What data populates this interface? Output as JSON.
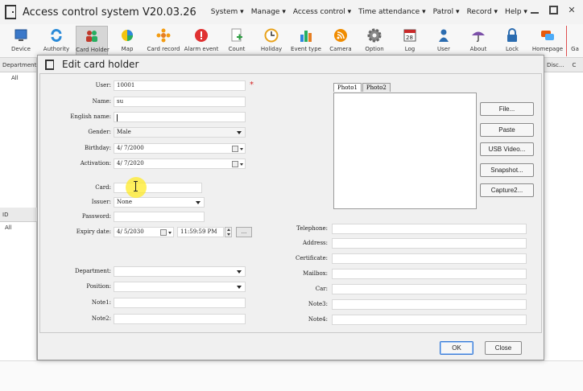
{
  "app": {
    "title": "Access control system V20.03.26",
    "menu": [
      "System ▾",
      "Manage ▾",
      "Access control ▾",
      "Time attendance ▾",
      "Patrol ▾",
      "Record ▾",
      "Help ▾"
    ]
  },
  "toolbar": {
    "items": [
      {
        "label": "Device",
        "icon": "monitor-icon"
      },
      {
        "label": "Authority",
        "icon": "refresh-arrows-icon"
      },
      {
        "label": "Card Holder",
        "icon": "people-icon"
      },
      {
        "label": "Map",
        "icon": "pie-map-icon"
      },
      {
        "label": "Card record",
        "icon": "flower-icon"
      },
      {
        "label": "Alarm event",
        "icon": "alert-icon"
      },
      {
        "label": "Count",
        "icon": "doc-plus-icon"
      },
      {
        "label": "Holiday",
        "icon": "clock-icon"
      },
      {
        "label": "Event type",
        "icon": "bar-chart-icon"
      },
      {
        "label": "Camera",
        "icon": "rss-icon"
      },
      {
        "label": "Option",
        "icon": "gear-icon"
      },
      {
        "label": "Log",
        "icon": "calendar-icon"
      },
      {
        "label": "User",
        "icon": "user-icon"
      },
      {
        "label": "About",
        "icon": "umbrella-icon"
      },
      {
        "label": "Lock",
        "icon": "lock-icon"
      },
      {
        "label": "Homepage",
        "icon": "chat-icon"
      },
      {
        "label": "Ga",
        "icon": "partial-icon"
      }
    ]
  },
  "background": {
    "left_header_top": "Department",
    "left_value_top": "All",
    "left_header_bottom": "ID",
    "left_value_bottom": "All",
    "right_header": [
      "Disc...",
      "C"
    ]
  },
  "dialog": {
    "title": "Edit card holder",
    "fields": {
      "user_label": "User:",
      "user_value": "10001",
      "name_label": "Name:",
      "name_value": "su",
      "english_name_label": "English name:",
      "english_name_value": "",
      "gender_label": "Gender:",
      "gender_value": "Male",
      "birthday_label": "Birthday:",
      "birthday_value": "4/ 7/2000",
      "activation_label": "Activation:",
      "activation_value": "4/ 7/2020",
      "card_label": "Card:",
      "card_value": "",
      "issuer_label": "Issuer:",
      "issuer_value": "None",
      "password_label": "Password:",
      "password_value": "",
      "expiry_label": "Expiry date:",
      "expiry_date_value": "4/ 5/2030",
      "expiry_time_value": "11:59:59 PM",
      "department_label": "Department:",
      "department_value": "",
      "position_label": "Position:",
      "position_value": "",
      "note1_label": "Note1:",
      "note1_value": "",
      "note2_label": "Note2:",
      "note2_value": "",
      "telephone_label": "Telephone:",
      "telephone_value": "",
      "address_label": "Address:",
      "address_value": "",
      "certificate_label": "Certificate:",
      "certificate_value": "",
      "mailbox_label": "Mailbox:",
      "mailbox_value": "",
      "car_label": "Car:",
      "car_value": "",
      "note3_label": "Note3:",
      "note3_value": "",
      "note4_label": "Note4:",
      "note4_value": ""
    },
    "required_mark": "*",
    "dots_label": "...",
    "photo_tabs": [
      "Photo1",
      "Photo2"
    ],
    "photo_buttons": [
      "File...",
      "Paste",
      "USB Video...",
      "Snapshot...",
      "Capture2..."
    ],
    "ok_label": "OK",
    "close_label": "Close"
  }
}
